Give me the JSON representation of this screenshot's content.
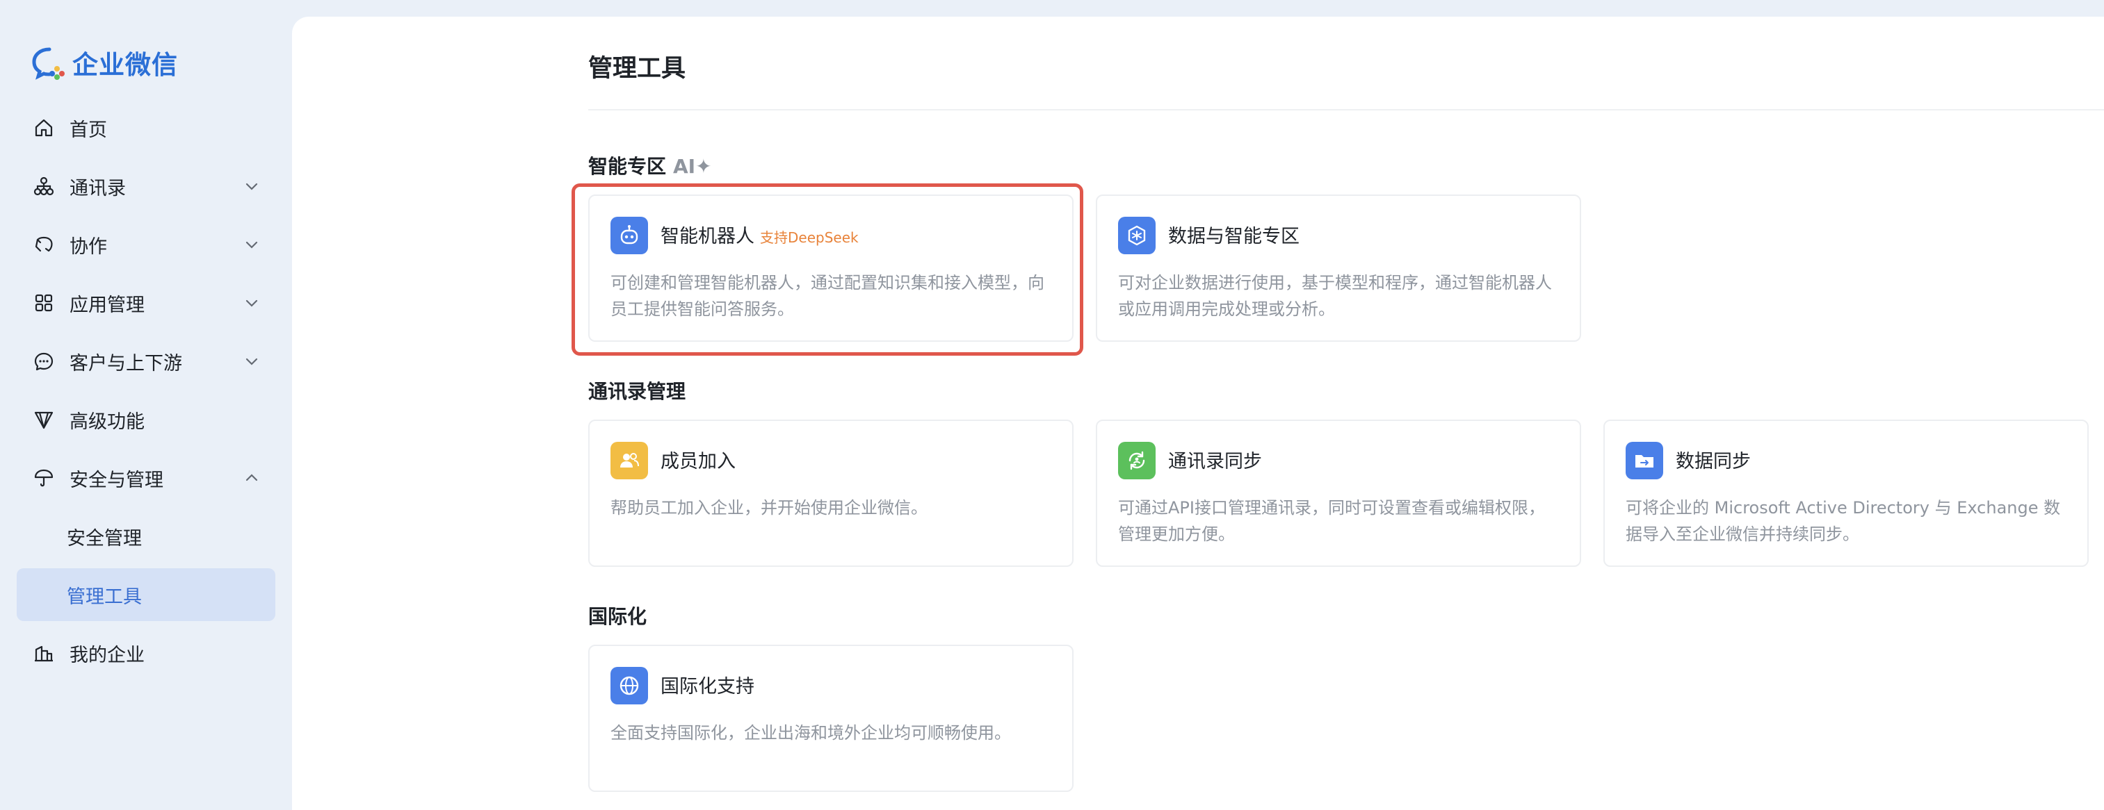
{
  "app": {
    "name": "企业微信"
  },
  "sidebar": {
    "items": [
      {
        "label": "首页",
        "icon": "home-icon"
      },
      {
        "label": "通讯录",
        "icon": "org-chart-icon"
      },
      {
        "label": "协作",
        "icon": "collaboration-icon"
      },
      {
        "label": "应用管理",
        "icon": "grid-icon"
      },
      {
        "label": "客户与上下游",
        "icon": "chat-icon"
      },
      {
        "label": "高级功能",
        "icon": "diamond-icon"
      },
      {
        "label": "安全与管理",
        "icon": "umbrella-icon"
      },
      {
        "label": "安全管理"
      },
      {
        "label": "管理工具",
        "active": true
      },
      {
        "label": "我的企业",
        "icon": "building-icon"
      }
    ]
  },
  "main": {
    "title": "管理工具",
    "sections": [
      {
        "title": "智能专区",
        "suffix": "AI✦",
        "cards": [
          {
            "title": "智能机器人",
            "tag": "支持DeepSeek",
            "desc": "可创建和管理智能机器人，通过配置知识集和接入模型，向员工提供智能问答服务。",
            "icon": "robot-icon",
            "color": "#4a7fe8"
          },
          {
            "title": "数据与智能专区",
            "desc": "可对企业数据进行使用，基于模型和程序，通过智能机器人或应用调用完成处理或分析。",
            "icon": "data-hex-icon",
            "color": "#4a7fe8"
          }
        ]
      },
      {
        "title": "通讯录管理",
        "cards": [
          {
            "title": "成员加入",
            "desc": "帮助员工加入企业，并开始使用企业微信。",
            "icon": "members-icon",
            "color": "#f2bd44"
          },
          {
            "title": "通讯录同步",
            "desc": "可通过API接口管理通讯录，同时可设置查看或编辑权限，管理更加方便。",
            "icon": "sync-icon",
            "color": "#5cc05c"
          },
          {
            "title": "数据同步",
            "desc": "可将企业的 Microsoft Active Directory 与 Exchange 数据导入至企业微信并持续同步。",
            "icon": "folder-sync-icon",
            "color": "#4a7fe8"
          }
        ]
      },
      {
        "title": "国际化",
        "cards": [
          {
            "title": "国际化支持",
            "desc": "全面支持国际化，企业出海和境外企业均可顺畅使用。",
            "icon": "globe-icon",
            "color": "#4a7fe8"
          }
        ]
      }
    ]
  },
  "colors": {
    "accent": "#3a6fd1",
    "highlight_border": "#e0574b",
    "tag": "#e8833a",
    "sidebar_bg": "#eaf0f8",
    "active_bg": "#d5e1f6"
  }
}
